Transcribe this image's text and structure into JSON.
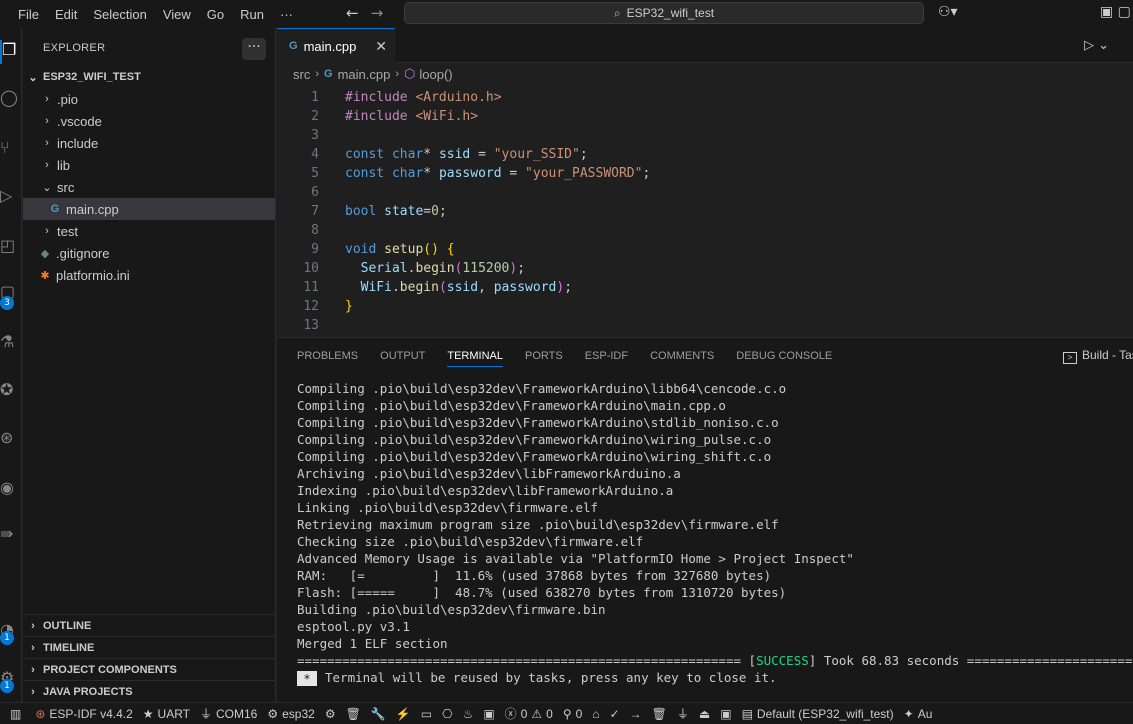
{
  "menu": [
    "File",
    "Edit",
    "Selection",
    "View",
    "Go",
    "Run",
    "···"
  ],
  "nav": {
    "back_icon": "arrow-left-icon",
    "forward_icon": "arrow-right-icon"
  },
  "search": {
    "text": "ESP32_wifi_test"
  },
  "sidebar": {
    "title": "EXPLORER",
    "more": "···",
    "project": "ESP32_WIFI_TEST",
    "items": [
      {
        "label": ".pio",
        "kind": "folder",
        "expanded": false
      },
      {
        "label": ".vscode",
        "kind": "folder",
        "expanded": false
      },
      {
        "label": "include",
        "kind": "folder",
        "expanded": false
      },
      {
        "label": "lib",
        "kind": "folder",
        "expanded": false
      },
      {
        "label": "src",
        "kind": "folder",
        "expanded": true
      },
      {
        "label": "main.cpp",
        "kind": "cpp-file",
        "selected": true
      },
      {
        "label": "test",
        "kind": "folder",
        "expanded": false
      },
      {
        "label": ".gitignore",
        "kind": "git-file"
      },
      {
        "label": "platformio.ini",
        "kind": "platformio-file"
      }
    ],
    "sections": [
      "OUTLINE",
      "TIMELINE",
      "PROJECT COMPONENTS",
      "JAVA PROJECTS"
    ]
  },
  "activity": {
    "badges": [
      "3",
      "1",
      "1"
    ]
  },
  "tabs": [
    {
      "label": "main.cpp",
      "close": "✕"
    }
  ],
  "breadcrumb": {
    "folder": "src",
    "file": "main.cpp",
    "symbol": "loop()"
  },
  "editor": {
    "line_numbers": [
      "1",
      "2",
      "3",
      "4",
      "5",
      "6",
      "7",
      "8",
      "9",
      "10",
      "11",
      "12",
      "13"
    ]
  },
  "panel": {
    "tabs": [
      "PROBLEMS",
      "OUTPUT",
      "TERMINAL",
      "PORTS",
      "ESP-IDF",
      "COMMENTS",
      "DEBUG CONSOLE"
    ],
    "active_tab": "TERMINAL",
    "task": "Build - Tas",
    "terminal": [
      "Compiling .pio\\build\\esp32dev\\FrameworkArduino\\libb64\\cencode.c.o",
      "Compiling .pio\\build\\esp32dev\\FrameworkArduino\\main.cpp.o",
      "Compiling .pio\\build\\esp32dev\\FrameworkArduino\\stdlib_noniso.c.o",
      "Compiling .pio\\build\\esp32dev\\FrameworkArduino\\wiring_pulse.c.o",
      "Compiling .pio\\build\\esp32dev\\FrameworkArduino\\wiring_shift.c.o",
      "Archiving .pio\\build\\esp32dev\\libFrameworkArduino.a",
      "Indexing .pio\\build\\esp32dev\\libFrameworkArduino.a",
      "Linking .pio\\build\\esp32dev\\firmware.elf",
      "Retrieving maximum program size .pio\\build\\esp32dev\\firmware.elf",
      "Checking size .pio\\build\\esp32dev\\firmware.elf",
      "Advanced Memory Usage is available via \"PlatformIO Home > Project Inspect\"",
      "RAM:   [=         ]  11.6% (used 37868 bytes from 327680 bytes)",
      "Flash: [=====     ]  48.7% (used 638270 bytes from 1310720 bytes)",
      "Building .pio\\build\\esp32dev\\firmware.bin",
      "esptool.py v3.1",
      "Merged 1 ELF section"
    ],
    "success_prefix": "=========================================================== [",
    "success_word": "SUCCESS",
    "success_suffix": "] Took 68.83 seconds ==================================",
    "reuse_star": "*",
    "reuse_msg": "Terminal will be reused by tasks, press any key to close it."
  },
  "statusbar": {
    "espidf": "ESP-IDF v4.4.2",
    "uart": "UART",
    "com": "COM16",
    "target": "esp32",
    "errors": "0",
    "warnings": "0",
    "ports": "0",
    "default": "Default (ESP32_wifi_test)",
    "au": "Au"
  },
  "colors": {
    "accent": "#0078d4",
    "success": "#23d18b"
  }
}
